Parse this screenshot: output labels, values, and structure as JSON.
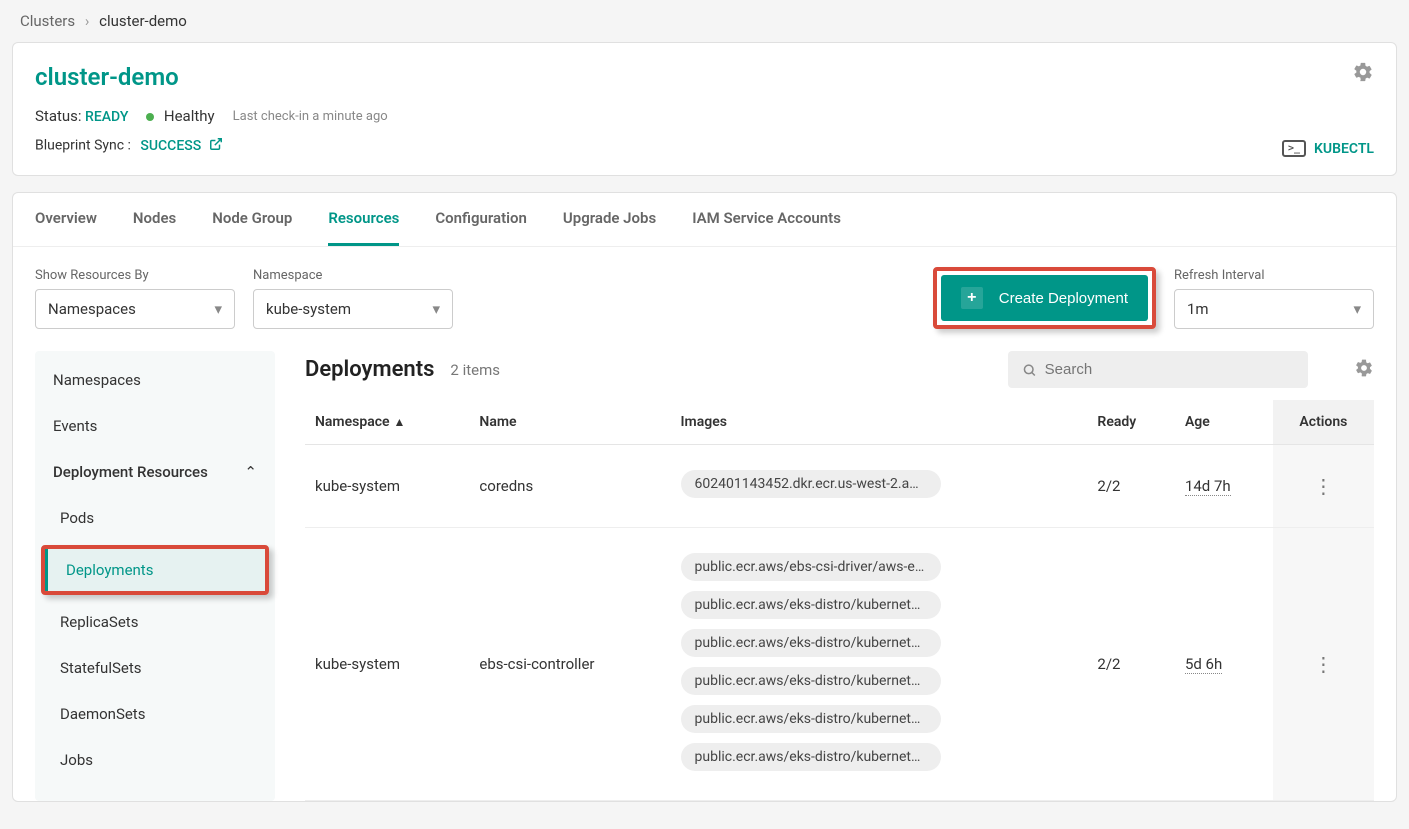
{
  "breadcrumb": {
    "root": "Clusters",
    "current": "cluster-demo"
  },
  "header": {
    "title": "cluster-demo",
    "status_label": "Status:",
    "status_value": "READY",
    "health": "Healthy",
    "checkin": "Last check-in a minute ago",
    "blueprint_label": "Blueprint Sync :",
    "blueprint_value": "SUCCESS",
    "kubectl": "KUBECTL"
  },
  "tabs": [
    "Overview",
    "Nodes",
    "Node Group",
    "Resources",
    "Configuration",
    "Upgrade Jobs",
    "IAM Service Accounts"
  ],
  "active_tab": "Resources",
  "filters": {
    "show_by_label": "Show Resources By",
    "show_by_value": "Namespaces",
    "namespace_label": "Namespace",
    "namespace_value": "kube-system",
    "refresh_label": "Refresh Interval",
    "refresh_value": "1m"
  },
  "create_button": "Create Deployment",
  "sidebar": {
    "top": [
      "Namespaces",
      "Events"
    ],
    "section": "Deployment Resources",
    "subs": [
      "Pods",
      "Deployments",
      "ReplicaSets",
      "StatefulSets",
      "DaemonSets",
      "Jobs"
    ],
    "active_sub": "Deployments"
  },
  "main": {
    "title": "Deployments",
    "count": "2 items",
    "search_placeholder": "Search",
    "columns": [
      "Namespace",
      "Name",
      "Images",
      "Ready",
      "Age",
      "Actions"
    ],
    "rows": [
      {
        "namespace": "kube-system",
        "name": "coredns",
        "images": [
          "602401143452.dkr.ecr.us-west-2.ama…"
        ],
        "ready": "2/2",
        "age": "14d 7h"
      },
      {
        "namespace": "kube-system",
        "name": "ebs-csi-controller",
        "images": [
          "public.ecr.aws/ebs-csi-driver/aws-ebs-…",
          "public.ecr.aws/eks-distro/kubernetes-…",
          "public.ecr.aws/eks-distro/kubernetes-…",
          "public.ecr.aws/eks-distro/kubernetes-…",
          "public.ecr.aws/eks-distro/kubernetes-…",
          "public.ecr.aws/eks-distro/kubernetes-…"
        ],
        "ready": "2/2",
        "age": "5d 6h"
      }
    ]
  }
}
